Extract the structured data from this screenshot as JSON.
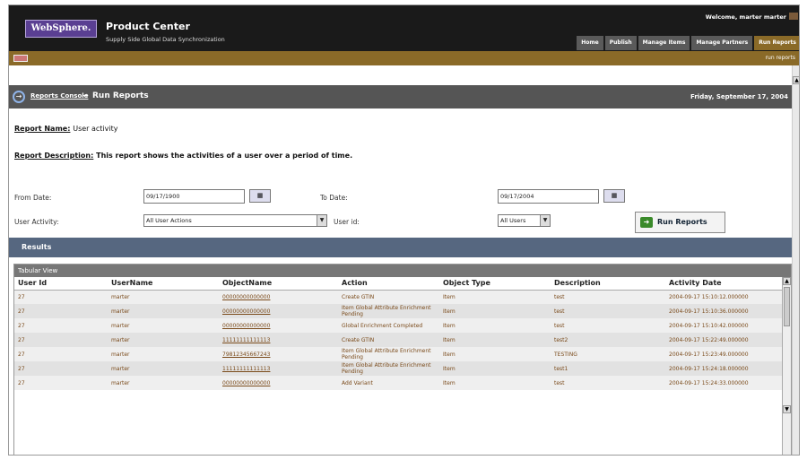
{
  "header": {
    "logo": "WebSphere.",
    "product": "Product Center",
    "tagline": "Supply Side Global Data Synchronization",
    "welcome": "Welcome, marter marter",
    "nav": [
      "Home",
      "Publish",
      "Manage Items",
      "Manage Partners",
      "Run Reports"
    ],
    "active_nav": "Run Reports",
    "subnav_text": "run reports"
  },
  "breadcrumb": {
    "parent": "Reports Console",
    "current": "Run Reports",
    "date": "Friday, September 17, 2004"
  },
  "report": {
    "name_label": "Report Name:",
    "name": "User activity",
    "desc_label": "Report Description:",
    "desc": "This report shows the activities of a user over a period of time."
  },
  "form": {
    "from_label": "From Date:",
    "from_value": "09/17/1900",
    "to_label": "To Date:",
    "to_value": "09/17/2004",
    "activity_label": "User Activity:",
    "activity_value": "All User Actions",
    "userid_label": "User id:",
    "userid_value": "All Users",
    "run_label": "Run Reports"
  },
  "results": {
    "title": "Results",
    "view_title": "Tabular View",
    "columns": [
      "User Id",
      "UserName",
      "ObjectName",
      "Action",
      "Object Type",
      "Description",
      "Activity Date"
    ],
    "rows": [
      [
        "27",
        "marter",
        "00000000000000",
        "Create GTIN",
        "Item",
        "test",
        "2004-09-17 15:10:12.000000"
      ],
      [
        "27",
        "marter",
        "00000000000000",
        "Item Global Attribute Enrichment Pending",
        "Item",
        "test",
        "2004-09-17 15:10:36.000000"
      ],
      [
        "27",
        "marter",
        "00000000000000",
        "Global Enrichment Completed",
        "Item",
        "test",
        "2004-09-17 15:10:42.000000"
      ],
      [
        "27",
        "marter",
        "11111111111113",
        "Create GTIN",
        "Item",
        "test2",
        "2004-09-17 15:22:49.000000"
      ],
      [
        "27",
        "marter",
        "79812345667243",
        "Item Global Attribute Enrichment Pending",
        "Item",
        "TESTING",
        "2004-09-17 15:23:49.000000"
      ],
      [
        "27",
        "marter",
        "11111111111113",
        "Item Global Attribute Enrichment Pending",
        "Item",
        "test1",
        "2004-09-17 15:24:18.000000"
      ],
      [
        "27",
        "marter",
        "00000000000000",
        "Add Variant",
        "Item",
        "test",
        "2004-09-17 15:24:33.000000"
      ]
    ]
  },
  "colors": {
    "topbar": "#1a1a1a",
    "accent": "#8a6a28",
    "results_bar": "#566780",
    "link": "#7a4a1a"
  }
}
